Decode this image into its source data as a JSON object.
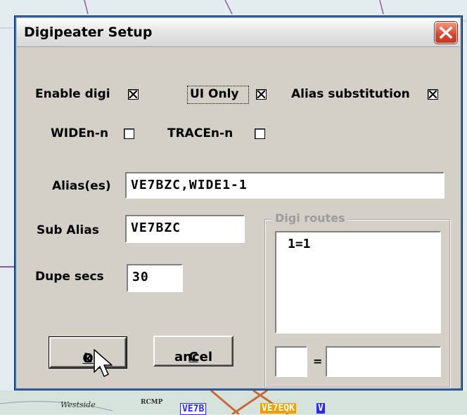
{
  "map": {
    "labels": [
      "Westside",
      "RCMP"
    ],
    "tags": [
      "VE7B",
      "VE7EQK",
      "V"
    ],
    "colors": {
      "water": "#e3ecef",
      "roads": "#8a5aa0",
      "land": "#c8d8c0",
      "tag_blue": "#2a2aff",
      "tag_orange": "#f0a000"
    }
  },
  "dialog": {
    "title": "Digipeater Setup",
    "close_icon": "close-icon"
  },
  "options": {
    "enable_digi": {
      "label": "Enable digi",
      "checked": true
    },
    "ui_only": {
      "label": "UI Only",
      "checked": true
    },
    "alias_substitution": {
      "label": "Alias substitution",
      "checked": true
    },
    "widen_n": {
      "label": "WIDEn-n",
      "checked": false
    },
    "tracen_n": {
      "label": "TRACEn-n",
      "checked": false
    }
  },
  "fields": {
    "aliases": {
      "label": "Alias(es)",
      "value": "VE7BZC,WIDE1-1"
    },
    "sub_alias": {
      "label": "Sub Alias",
      "value": "VE7BZC"
    },
    "dupe_secs": {
      "label": "Dupe secs",
      "value": "30"
    }
  },
  "digi_routes": {
    "title": "Digi routes",
    "items": [
      "1=1"
    ],
    "equals": "=",
    "left_value": "",
    "right_value": ""
  },
  "buttons": {
    "ok": {
      "mnemonic": "O",
      "rest": "k"
    },
    "cancel": {
      "mnemonic": "C",
      "rest": "ancel"
    }
  }
}
